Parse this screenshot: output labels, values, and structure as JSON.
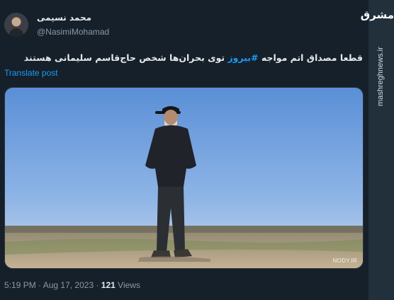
{
  "author": {
    "display_name": "محمد نسیمی",
    "handle": "@NasimiMohamad"
  },
  "tweet": {
    "text_before": "قطعا مصداق اتم مواجه ",
    "hashtag": "#بیروز",
    "text_after": " توی بحران‌ها شخص حاج‌قاسم سلیمانی هستند",
    "translate_label": "Translate post"
  },
  "media": {
    "watermark": "NODY.IR"
  },
  "meta": {
    "time": "5:19 PM",
    "separator": " · ",
    "date": "Aug 17, 2023",
    "views_count": "121",
    "views_label": " Views"
  },
  "side_brand": {
    "logo": "مشرق",
    "url": "mashreghnews.ir"
  },
  "colors": {
    "background": "#15202b",
    "link": "#1d9bf0",
    "muted": "#8b98a5",
    "text": "#e7e9ea"
  }
}
